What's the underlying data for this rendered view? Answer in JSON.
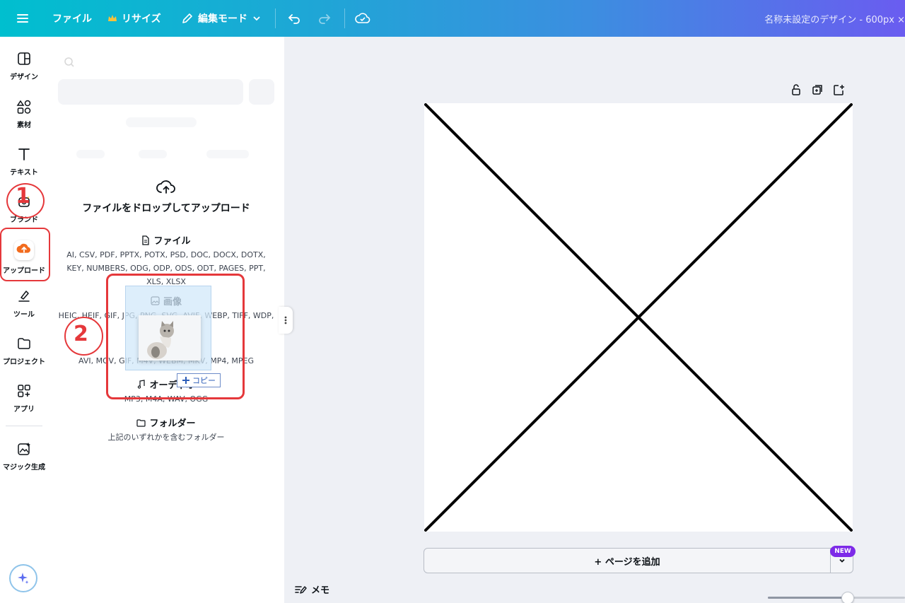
{
  "topbar": {
    "file": "ファイル",
    "resize": "リサイズ",
    "edit_mode": "編集モード",
    "doc_title": "名称未設定のデザイン - 600px ×"
  },
  "rail": {
    "design": "デザイン",
    "elements": "素材",
    "text": "テキスト",
    "brand": "ブランド",
    "upload": "アップロード",
    "tools": "ツール",
    "projects": "プロジェクト",
    "apps": "アプリ",
    "magic": "マジック生成"
  },
  "upload_panel": {
    "drop_title": "ファイルをドロップしてアップロード",
    "sections": [
      {
        "title": "ファイル",
        "formats": "AI, CSV, PDF, PPTX, POTX, PSD, DOC, DOCX, DOTX, KEY, NUMBERS, ODG, ODP, ODS, ODT, PAGES, PPT, XLS, XLSX"
      },
      {
        "title": "画像",
        "formats": "HEIC, HEIF, GIF, JPG, PNG, SVG, AVIF, WEBP, TIFF, WDP,"
      },
      {
        "title": "動画",
        "formats": "AVI, MOV, GIF, M4V, WEBM, MKV, MP4, MPEG"
      },
      {
        "title": "オーディオ",
        "formats": "MP3, M4A, WAV, OGG"
      },
      {
        "title": "フォルダー",
        "formats": "上記のいずれかを含むフォルダー"
      }
    ],
    "drag_copy": "コピー"
  },
  "annotations": {
    "step1": "1",
    "step2": "2",
    "color": "#e5383b"
  },
  "canvas": {
    "add_page": "+ ページを追加",
    "new_badge": "NEW",
    "memo": "メモ",
    "zoom_level": 0.58
  },
  "colors": {
    "topbar_start": "#00bfcf",
    "topbar_end": "#6a5cf0",
    "accent_purple": "#7d2ae8",
    "upload_orange": "#f26b1d"
  }
}
